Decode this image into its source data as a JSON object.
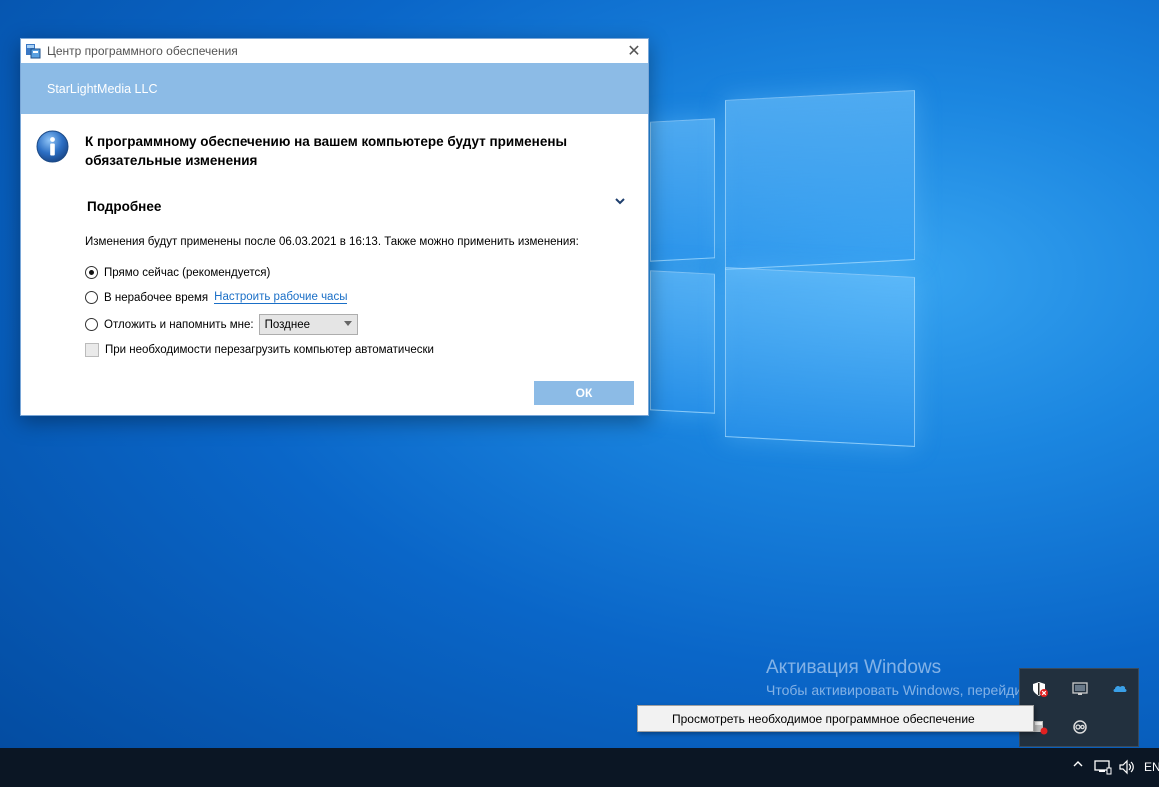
{
  "dialog": {
    "title": "Центр программного обеспечения",
    "vendor": "StarLightMedia LLC",
    "headline": "К программному обеспечению на вашем компьютере будут применены обязательные изменения",
    "details_title": "Подробнее",
    "description": "Изменения будут применены после 06.03.2021 в 16:13. Также можно применить изменения:",
    "options": [
      {
        "label": "Прямо сейчас (рекомендуется)",
        "selected": true
      },
      {
        "label": "В нерабочее время",
        "link": "Настроить рабочие часы",
        "selected": false
      },
      {
        "label": "Отложить и напомнить мне:",
        "select_value": "Позднее",
        "selected": false
      }
    ],
    "restart_label": "При необходимости перезагрузить компьютер автоматически",
    "restart_checked": false,
    "ok_label": "ОК",
    "close_glyph": "✕"
  },
  "watermark": {
    "title": "Активация Windows",
    "subtitle": "Чтобы активировать Windows, перейдите в раздел \"Пар"
  },
  "context_menu": {
    "item": "Просмотреть необходимое программное обеспечение"
  },
  "taskbar": {
    "chevron_glyph": "^",
    "volume_glyph": "🔊",
    "language": "EN"
  },
  "colors": {
    "accent": "#8cbbe6",
    "link": "#1a6fc7",
    "taskbar": "#0b1624"
  }
}
